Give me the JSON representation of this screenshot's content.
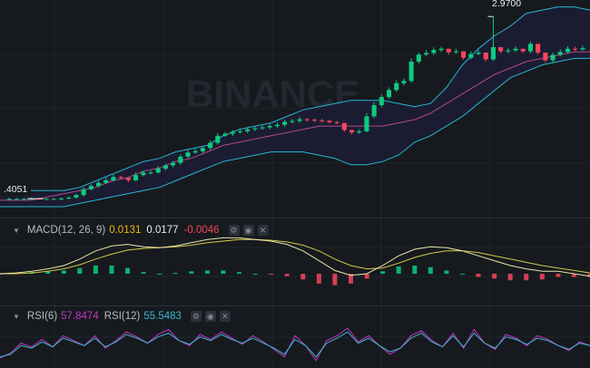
{
  "watermark": "BINANCE",
  "colors": {
    "background": "#161a1e",
    "up": "#0ecb81",
    "down": "#f6465d",
    "bollinger_band": "#26b6d4",
    "bollinger_mid": "#b1488c",
    "band_fill": "#1c1d33",
    "macd_dif": "#e9e3a9",
    "macd_dea": "#d4c949",
    "rsi6": "#c535c6",
    "rsi12": "#3fb6d0",
    "grid": "#1f242b"
  },
  "price_pane": {
    "high_label": "2.9700",
    "low_label": ".4051"
  },
  "macd_pane": {
    "label": "MACD(12, 26, 9)",
    "dif": "0.0131",
    "dea": "0.0177",
    "macd": "-0.0046"
  },
  "rsi_pane": {
    "label6": "RSI(6)",
    "value6": "57.8474",
    "label12": "RSI(12)",
    "value12": "55.5483"
  },
  "chart_data": [
    {
      "type": "candlestick",
      "title": "",
      "y_range": [
        2.38,
        3.01
      ],
      "open": [
        2.403,
        2.404,
        2.404,
        2.404,
        2.405,
        2.404,
        2.404,
        2.404,
        2.405,
        2.408,
        2.416,
        2.434,
        2.444,
        2.454,
        2.462,
        2.472,
        2.47,
        2.462,
        2.478,
        2.486,
        2.486,
        2.498,
        2.508,
        2.516,
        2.535,
        2.548,
        2.552,
        2.562,
        2.578,
        2.6,
        2.606,
        2.612,
        2.614,
        2.62,
        2.623,
        2.626,
        2.63,
        2.634,
        2.643,
        2.646,
        2.651,
        2.65,
        2.648,
        2.647,
        2.642,
        2.64,
        2.618,
        2.61,
        2.614,
        2.66,
        2.695,
        2.72,
        2.742,
        2.763,
        2.77,
        2.83,
        2.852,
        2.857,
        2.866,
        2.87,
        2.859,
        2.862,
        2.842,
        2.854,
        2.858,
        2.837,
        2.875,
        2.862,
        2.865,
        2.87,
        2.862,
        2.885,
        2.858,
        2.834,
        2.851,
        2.86,
        2.87,
        2.868
      ],
      "close": [
        2.404,
        2.404,
        2.404,
        2.405,
        2.404,
        2.404,
        2.404,
        2.405,
        2.408,
        2.416,
        2.434,
        2.444,
        2.454,
        2.462,
        2.472,
        2.47,
        2.462,
        2.478,
        2.486,
        2.486,
        2.498,
        2.508,
        2.516,
        2.535,
        2.548,
        2.552,
        2.562,
        2.578,
        2.6,
        2.606,
        2.612,
        2.614,
        2.62,
        2.623,
        2.626,
        2.63,
        2.634,
        2.643,
        2.646,
        2.651,
        2.65,
        2.648,
        2.647,
        2.642,
        2.64,
        2.618,
        2.61,
        2.614,
        2.66,
        2.695,
        2.72,
        2.742,
        2.763,
        2.77,
        2.83,
        2.852,
        2.857,
        2.866,
        2.87,
        2.859,
        2.862,
        2.842,
        2.854,
        2.858,
        2.837,
        2.875,
        2.862,
        2.865,
        2.87,
        2.862,
        2.885,
        2.858,
        2.834,
        2.851,
        2.86,
        2.87,
        2.868,
        2.872
      ],
      "high": [
        2.408,
        2.407,
        2.407,
        2.408,
        2.408,
        2.407,
        2.407,
        2.408,
        2.412,
        2.42,
        2.44,
        2.45,
        2.46,
        2.47,
        2.48,
        2.476,
        2.47,
        2.486,
        2.492,
        2.492,
        2.506,
        2.514,
        2.522,
        2.542,
        2.556,
        2.56,
        2.57,
        2.586,
        2.608,
        2.612,
        2.618,
        2.62,
        2.626,
        2.63,
        2.632,
        2.636,
        2.64,
        2.65,
        2.652,
        2.658,
        2.656,
        2.654,
        2.652,
        2.648,
        2.646,
        2.626,
        2.616,
        2.62,
        2.67,
        2.704,
        2.728,
        2.75,
        2.772,
        2.778,
        2.84,
        2.858,
        2.866,
        2.874,
        2.876,
        2.866,
        2.87,
        2.85,
        2.862,
        2.866,
        2.844,
        2.97,
        2.87,
        2.872,
        2.878,
        2.87,
        2.892,
        2.866,
        2.842,
        2.858,
        2.868,
        2.878,
        2.876,
        2.88
      ],
      "low": [
        2.4,
        2.401,
        2.401,
        2.401,
        2.401,
        2.401,
        2.401,
        2.401,
        2.403,
        2.405,
        2.412,
        2.43,
        2.44,
        2.45,
        2.458,
        2.464,
        2.456,
        2.458,
        2.474,
        2.48,
        2.482,
        2.492,
        2.502,
        2.51,
        2.53,
        2.544,
        2.546,
        2.556,
        2.572,
        2.596,
        2.6,
        2.606,
        2.608,
        2.614,
        2.618,
        2.62,
        2.624,
        2.628,
        2.638,
        2.64,
        2.644,
        2.642,
        2.64,
        2.638,
        2.636,
        2.612,
        2.604,
        2.606,
        2.61,
        2.654,
        2.688,
        2.714,
        2.736,
        2.756,
        2.764,
        2.824,
        2.846,
        2.85,
        2.86,
        2.852,
        2.854,
        2.836,
        2.836,
        2.85,
        2.83,
        2.832,
        2.856,
        2.856,
        2.86,
        2.856,
        2.856,
        2.852,
        2.826,
        2.828,
        2.846,
        2.856,
        2.862,
        2.864
      ],
      "bollinger": {
        "upper": [
          2.44,
          2.44,
          2.43,
          2.43,
          2.43,
          2.44,
          2.46,
          2.48,
          2.5,
          2.52,
          2.53,
          2.55,
          2.56,
          2.57,
          2.6,
          2.62,
          2.63,
          2.64,
          2.66,
          2.68,
          2.69,
          2.7,
          2.71,
          2.71,
          2.71,
          2.7,
          2.69,
          2.7,
          2.75,
          2.82,
          2.87,
          2.91,
          2.94,
          2.98,
          2.99,
          3.0,
          3.0,
          2.99
        ],
        "middle": [
          2.4,
          2.4,
          2.4,
          2.41,
          2.42,
          2.43,
          2.44,
          2.46,
          2.47,
          2.49,
          2.5,
          2.52,
          2.53,
          2.55,
          2.57,
          2.58,
          2.59,
          2.6,
          2.61,
          2.62,
          2.63,
          2.63,
          2.63,
          2.63,
          2.63,
          2.64,
          2.65,
          2.67,
          2.7,
          2.73,
          2.76,
          2.79,
          2.81,
          2.83,
          2.84,
          2.85,
          2.86,
          2.86
        ],
        "lower": [
          2.38,
          2.38,
          2.38,
          2.38,
          2.38,
          2.39,
          2.4,
          2.41,
          2.42,
          2.43,
          2.44,
          2.46,
          2.48,
          2.5,
          2.52,
          2.53,
          2.54,
          2.55,
          2.55,
          2.55,
          2.54,
          2.53,
          2.51,
          2.51,
          2.52,
          2.54,
          2.58,
          2.6,
          2.63,
          2.66,
          2.7,
          2.74,
          2.78,
          2.8,
          2.82,
          2.83,
          2.84,
          2.84
        ]
      }
    },
    {
      "type": "line",
      "title": "MACD(12, 26, 9)",
      "y_range": [
        -0.03,
        0.05
      ],
      "dif": [
        0.0,
        0.001,
        0.003,
        0.006,
        0.01,
        0.018,
        0.028,
        0.034,
        0.036,
        0.033,
        0.032,
        0.034,
        0.038,
        0.042,
        0.044,
        0.044,
        0.042,
        0.04,
        0.036,
        0.028,
        0.016,
        0.004,
        -0.002,
        0.0,
        0.01,
        0.022,
        0.03,
        0.033,
        0.032,
        0.028,
        0.022,
        0.016,
        0.01,
        0.006,
        0.003,
        0.003,
        0.0,
        -0.003
      ],
      "dea": [
        0.0,
        0.0,
        0.001,
        0.003,
        0.006,
        0.011,
        0.018,
        0.024,
        0.029,
        0.031,
        0.032,
        0.033,
        0.035,
        0.038,
        0.04,
        0.042,
        0.042,
        0.041,
        0.039,
        0.035,
        0.028,
        0.018,
        0.01,
        0.006,
        0.007,
        0.013,
        0.02,
        0.025,
        0.028,
        0.028,
        0.026,
        0.022,
        0.018,
        0.014,
        0.01,
        0.007,
        0.004,
        0.001
      ],
      "histogram": [
        0.0,
        0.001,
        0.002,
        0.003,
        0.004,
        0.007,
        0.01,
        0.01,
        0.007,
        0.002,
        0.0,
        0.001,
        0.003,
        0.004,
        0.004,
        0.002,
        0.0,
        -0.001,
        -0.003,
        -0.007,
        -0.012,
        -0.014,
        -0.012,
        -0.006,
        0.003,
        0.009,
        0.01,
        0.008,
        0.004,
        0.0,
        -0.004,
        -0.006,
        -0.008,
        -0.008,
        -0.007,
        -0.004,
        -0.004,
        -0.004
      ]
    },
    {
      "type": "line",
      "title": "RSI",
      "y_range": [
        40,
        75
      ],
      "series": [
        {
          "name": "RSI(6)",
          "values": [
            48,
            52,
            60,
            57,
            63,
            57,
            66,
            62,
            58,
            66,
            56,
            62,
            69,
            65,
            60,
            67,
            71,
            62,
            58,
            67,
            63,
            69,
            64,
            59,
            66,
            61,
            55,
            49,
            66,
            58,
            46,
            62,
            66,
            72,
            61,
            66,
            58,
            51,
            56,
            66,
            70,
            62,
            57,
            68,
            56,
            71,
            60,
            55,
            67,
            64,
            58,
            66,
            63,
            58,
            54,
            61,
            58
          ]
        },
        {
          "name": "RSI(12)",
          "values": [
            49,
            51,
            58,
            56,
            61,
            57,
            64,
            61,
            58,
            64,
            57,
            61,
            67,
            64,
            60,
            65,
            68,
            62,
            59,
            65,
            62,
            67,
            63,
            60,
            64,
            60,
            56,
            51,
            63,
            58,
            49,
            60,
            64,
            69,
            60,
            64,
            58,
            53,
            56,
            64,
            68,
            61,
            57,
            66,
            57,
            68,
            60,
            56,
            65,
            63,
            59,
            64,
            62,
            58,
            55,
            60,
            58
          ]
        }
      ]
    }
  ]
}
